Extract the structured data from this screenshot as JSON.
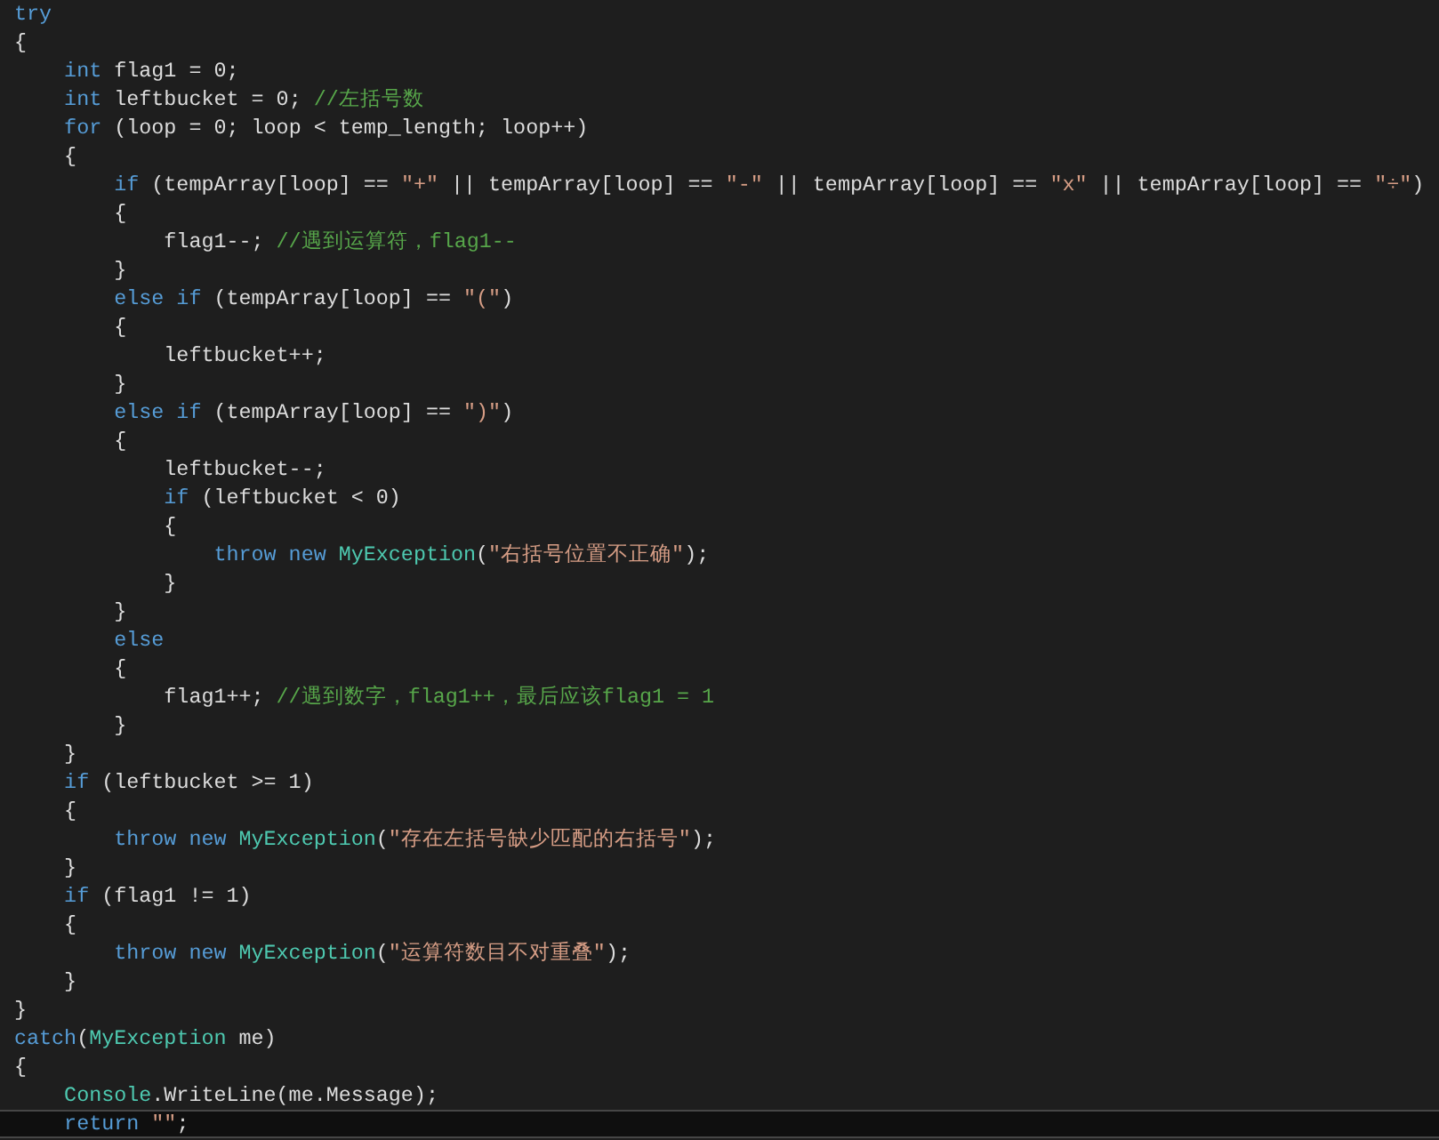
{
  "editor": {
    "lines": [
      {
        "current": false,
        "tokens": [
          {
            "kind": "keyword",
            "text": "try"
          }
        ]
      },
      {
        "current": false,
        "tokens": [
          {
            "kind": "plain",
            "text": "{"
          }
        ]
      },
      {
        "current": false,
        "tokens": [
          {
            "kind": "keyword",
            "text": "    int"
          },
          {
            "kind": "plain",
            "text": " flag1 = 0;"
          }
        ]
      },
      {
        "current": false,
        "tokens": [
          {
            "kind": "keyword",
            "text": "    int"
          },
          {
            "kind": "plain",
            "text": " leftbucket = 0; "
          },
          {
            "kind": "comment",
            "text": "//左括号数"
          }
        ]
      },
      {
        "current": false,
        "tokens": [
          {
            "kind": "keyword",
            "text": "    for"
          },
          {
            "kind": "plain",
            "text": " (loop = 0; loop < temp_length; loop++)"
          }
        ]
      },
      {
        "current": false,
        "tokens": [
          {
            "kind": "plain",
            "text": "    {"
          }
        ]
      },
      {
        "current": false,
        "tokens": [
          {
            "kind": "keyword",
            "text": "        if"
          },
          {
            "kind": "plain",
            "text": " (tempArray[loop] == "
          },
          {
            "kind": "string",
            "text": "\"+\""
          },
          {
            "kind": "plain",
            "text": " || tempArray[loop] == "
          },
          {
            "kind": "string",
            "text": "\"-\""
          },
          {
            "kind": "plain",
            "text": " || tempArray[loop] == "
          },
          {
            "kind": "string",
            "text": "\"x\""
          },
          {
            "kind": "plain",
            "text": " || tempArray[loop] == "
          },
          {
            "kind": "string",
            "text": "\"÷\""
          },
          {
            "kind": "plain",
            "text": ")"
          }
        ]
      },
      {
        "current": false,
        "tokens": [
          {
            "kind": "plain",
            "text": "        {"
          }
        ]
      },
      {
        "current": false,
        "tokens": [
          {
            "kind": "plain",
            "text": "            flag1--; "
          },
          {
            "kind": "comment",
            "text": "//遇到运算符，flag1--"
          }
        ]
      },
      {
        "current": false,
        "tokens": [
          {
            "kind": "plain",
            "text": "        }"
          }
        ]
      },
      {
        "current": false,
        "tokens": [
          {
            "kind": "keyword",
            "text": "        else if"
          },
          {
            "kind": "plain",
            "text": " (tempArray[loop] == "
          },
          {
            "kind": "string",
            "text": "\"(\""
          },
          {
            "kind": "plain",
            "text": ")"
          }
        ]
      },
      {
        "current": false,
        "tokens": [
          {
            "kind": "plain",
            "text": "        {"
          }
        ]
      },
      {
        "current": false,
        "tokens": [
          {
            "kind": "plain",
            "text": "            leftbucket++;"
          }
        ]
      },
      {
        "current": false,
        "tokens": [
          {
            "kind": "plain",
            "text": "        }"
          }
        ]
      },
      {
        "current": false,
        "tokens": [
          {
            "kind": "keyword",
            "text": "        else if"
          },
          {
            "kind": "plain",
            "text": " (tempArray[loop] == "
          },
          {
            "kind": "string",
            "text": "\")\""
          },
          {
            "kind": "plain",
            "text": ")"
          }
        ]
      },
      {
        "current": false,
        "tokens": [
          {
            "kind": "plain",
            "text": "        {"
          }
        ]
      },
      {
        "current": false,
        "tokens": [
          {
            "kind": "plain",
            "text": "            leftbucket--;"
          }
        ]
      },
      {
        "current": false,
        "tokens": [
          {
            "kind": "keyword",
            "text": "            if"
          },
          {
            "kind": "plain",
            "text": " (leftbucket < 0)"
          }
        ]
      },
      {
        "current": false,
        "tokens": [
          {
            "kind": "plain",
            "text": "            {"
          }
        ]
      },
      {
        "current": false,
        "tokens": [
          {
            "kind": "keyword",
            "text": "                throw new "
          },
          {
            "kind": "type",
            "text": "MyException"
          },
          {
            "kind": "plain",
            "text": "("
          },
          {
            "kind": "string",
            "text": "\"右括号位置不正确\""
          },
          {
            "kind": "plain",
            "text": ");"
          }
        ]
      },
      {
        "current": false,
        "tokens": [
          {
            "kind": "plain",
            "text": "            }"
          }
        ]
      },
      {
        "current": false,
        "tokens": [
          {
            "kind": "plain",
            "text": "        }"
          }
        ]
      },
      {
        "current": false,
        "tokens": [
          {
            "kind": "keyword",
            "text": "        else"
          }
        ]
      },
      {
        "current": false,
        "tokens": [
          {
            "kind": "plain",
            "text": "        {"
          }
        ]
      },
      {
        "current": false,
        "tokens": [
          {
            "kind": "plain",
            "text": "            flag1++; "
          },
          {
            "kind": "comment",
            "text": "//遇到数字，flag1++，最后应该flag1 = 1"
          }
        ]
      },
      {
        "current": false,
        "tokens": [
          {
            "kind": "plain",
            "text": "        }"
          }
        ]
      },
      {
        "current": false,
        "tokens": [
          {
            "kind": "plain",
            "text": "    }"
          }
        ]
      },
      {
        "current": false,
        "tokens": [
          {
            "kind": "keyword",
            "text": "    if"
          },
          {
            "kind": "plain",
            "text": " (leftbucket >= 1)"
          }
        ]
      },
      {
        "current": false,
        "tokens": [
          {
            "kind": "plain",
            "text": "    {"
          }
        ]
      },
      {
        "current": false,
        "tokens": [
          {
            "kind": "keyword",
            "text": "        throw new "
          },
          {
            "kind": "type",
            "text": "MyException"
          },
          {
            "kind": "plain",
            "text": "("
          },
          {
            "kind": "string",
            "text": "\"存在左括号缺少匹配的右括号\""
          },
          {
            "kind": "plain",
            "text": ");"
          }
        ]
      },
      {
        "current": false,
        "tokens": [
          {
            "kind": "plain",
            "text": "    }"
          }
        ]
      },
      {
        "current": false,
        "tokens": [
          {
            "kind": "keyword",
            "text": "    if"
          },
          {
            "kind": "plain",
            "text": " (flag1 != 1)"
          }
        ]
      },
      {
        "current": false,
        "tokens": [
          {
            "kind": "plain",
            "text": "    {"
          }
        ]
      },
      {
        "current": false,
        "tokens": [
          {
            "kind": "keyword",
            "text": "        throw new "
          },
          {
            "kind": "type",
            "text": "MyException"
          },
          {
            "kind": "plain",
            "text": "("
          },
          {
            "kind": "string",
            "text": "\"运算符数目不对重叠\""
          },
          {
            "kind": "plain",
            "text": ");"
          }
        ]
      },
      {
        "current": false,
        "tokens": [
          {
            "kind": "plain",
            "text": "    }"
          }
        ]
      },
      {
        "current": false,
        "tokens": [
          {
            "kind": "plain",
            "text": "}"
          }
        ]
      },
      {
        "current": false,
        "tokens": [
          {
            "kind": "keyword",
            "text": "catch"
          },
          {
            "kind": "plain",
            "text": "("
          },
          {
            "kind": "type",
            "text": "MyException"
          },
          {
            "kind": "plain",
            "text": " me)"
          }
        ]
      },
      {
        "current": false,
        "tokens": [
          {
            "kind": "plain",
            "text": "{"
          }
        ]
      },
      {
        "current": false,
        "tokens": [
          {
            "kind": "type",
            "text": "    Console"
          },
          {
            "kind": "plain",
            "text": ".WriteLine(me.Message);"
          }
        ]
      },
      {
        "current": true,
        "tokens": [
          {
            "kind": "keyword",
            "text": "    return "
          },
          {
            "kind": "string",
            "text": "\"\""
          },
          {
            "kind": "plain",
            "text": ";"
          }
        ]
      }
    ]
  }
}
